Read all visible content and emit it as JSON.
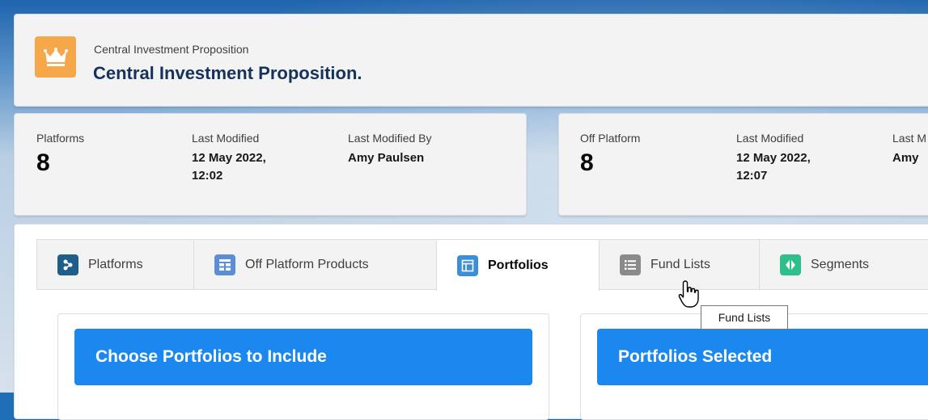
{
  "header": {
    "subtitle": "Central Investment Proposition",
    "title": "Central Investment Proposition.",
    "icon": "crown-icon",
    "icon_color": "#f5a74a"
  },
  "stats_left": {
    "platforms_label": "Platforms",
    "platforms_value": "8",
    "last_modified_label": "Last Modified",
    "last_modified_value": "12 May 2022,\n12:02",
    "last_modified_by_label": "Last Modified By",
    "last_modified_by_value": "Amy Paulsen"
  },
  "stats_right": {
    "off_platform_label": "Off Platform",
    "off_platform_value": "8",
    "last_modified_label": "Last Modified",
    "last_modified_value": "12 May 2022,\n12:07",
    "last_modified_by_label": "Last M",
    "last_modified_by_value": "Amy"
  },
  "tabs": [
    {
      "label": "Platforms",
      "icon": "platforms-icon",
      "color": "#1f5d8b"
    },
    {
      "label": "Off Platform Products",
      "icon": "grid-icon",
      "color": "#5a8fd8"
    },
    {
      "label": "Portfolios",
      "icon": "layout-icon",
      "color": "#3b8fd9",
      "active": true
    },
    {
      "label": "Fund Lists",
      "icon": "list-icon",
      "color": "#8a8a8a"
    },
    {
      "label": "Segments",
      "icon": "segments-icon",
      "color": "#2fbf8a"
    }
  ],
  "panels": {
    "left_title": "Choose Portfolios to Include",
    "right_title": "Portfolios Selected"
  },
  "tooltip": {
    "text": "Fund Lists"
  },
  "colors": {
    "accent": "#1b88ef",
    "background": "#1e6fb8"
  }
}
